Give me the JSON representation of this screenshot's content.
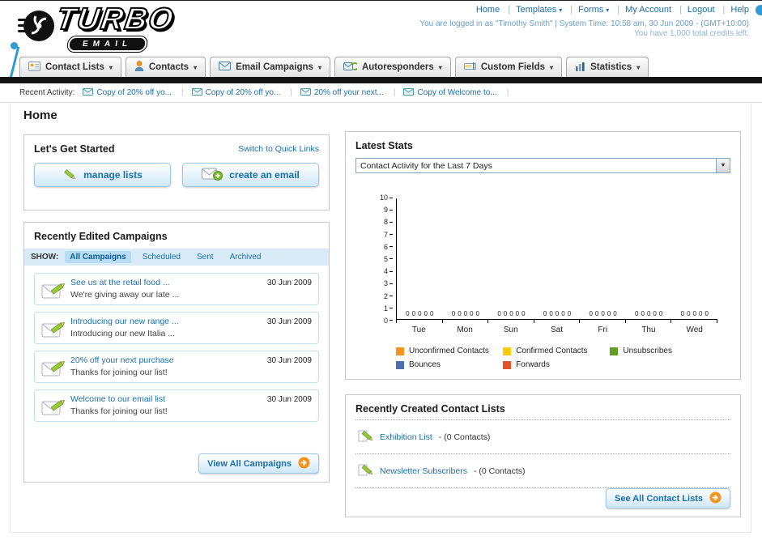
{
  "header": {
    "logo_title": "TURBO",
    "logo_subtitle": "EMAIL",
    "links": [
      "Home",
      "Templates",
      "Forms",
      "My Account",
      "Logout",
      "Help"
    ],
    "login_info": "You are logged in as \"Timothy Smith\" | System Time: 10:58 am, 30 Jun 2009 - (GMT+10:00)",
    "credits_info": "You have 1,000 total credits left."
  },
  "nav_tabs": [
    {
      "label": "Contact Lists"
    },
    {
      "label": "Contacts"
    },
    {
      "label": "Email Campaigns"
    },
    {
      "label": "Autoresponders"
    },
    {
      "label": "Custom Fields"
    },
    {
      "label": "Statistics"
    }
  ],
  "recent_activity": {
    "label": "Recent Activity:",
    "items": [
      "Copy of 20% off yo...",
      "Copy of 20% off yo...",
      "20% off your next...",
      "Copy of Welcome to..."
    ]
  },
  "page_title": "Home",
  "get_started": {
    "title": "Let's Get Started",
    "switch_link": "Switch to Quick Links",
    "manage_lists_label": "manage lists",
    "create_email_label": "create an email"
  },
  "campaigns": {
    "title": "Recently Edited Campaigns",
    "show_label": "SHOW:",
    "filters": [
      "All Campaigns",
      "Scheduled",
      "Sent",
      "Archived"
    ],
    "active_filter": "All Campaigns",
    "items": [
      {
        "title": "See us at the retail food ...",
        "subtitle": "We're giving away our late ...",
        "date": "30 Jun 2009"
      },
      {
        "title": "Introducing our new range ...",
        "subtitle": "Introducing our new Italia ...",
        "date": "30 Jun 2009"
      },
      {
        "title": "20% off your next purchase",
        "subtitle": "Thanks for joining our list!",
        "date": "30 Jun 2009"
      },
      {
        "title": "Welcome to our email list",
        "subtitle": "Thanks for joining our list!",
        "date": "30 Jun 2009"
      }
    ],
    "view_all_label": "View All Campaigns"
  },
  "latest_stats": {
    "title": "Latest Stats",
    "dropdown_value": "Contact Activity for the Last 7 Days"
  },
  "chart_data": {
    "type": "bar",
    "title": "Contact Activity for the Last 7 Days",
    "categories": [
      "Tue",
      "Mon",
      "Sun",
      "Sat",
      "Fri",
      "Thu",
      "Wed"
    ],
    "series": [
      {
        "name": "Unconfirmed Contacts",
        "color": "#F7941D",
        "values": [
          0,
          0,
          0,
          0,
          0,
          0,
          0
        ]
      },
      {
        "name": "Confirmed Contacts",
        "color": "#FFCB05",
        "values": [
          0,
          0,
          0,
          0,
          0,
          0,
          0
        ]
      },
      {
        "name": "Unsubscribes",
        "color": "#61A024",
        "values": [
          0,
          0,
          0,
          0,
          0,
          0,
          0
        ]
      },
      {
        "name": "Bounces",
        "color": "#4C6FAD",
        "values": [
          0,
          0,
          0,
          0,
          0,
          0,
          0
        ]
      },
      {
        "name": "Forwards",
        "color": "#E8502A",
        "values": [
          0,
          0,
          0,
          0,
          0,
          0,
          0
        ]
      }
    ],
    "ylim": [
      0,
      10
    ],
    "yticks": [
      10,
      9,
      8,
      7,
      6,
      5,
      4,
      3,
      2,
      1,
      0
    ],
    "grid": false,
    "legend_position": "bottom"
  },
  "contact_lists": {
    "title": "Recently Created Contact Lists",
    "items": [
      {
        "name": "Exhibition List",
        "detail": "- (0 Contacts)"
      },
      {
        "name": "Newsletter Subscribers",
        "detail": "- (0 Contacts)"
      }
    ],
    "see_all_label": "See All Contact Lists"
  }
}
